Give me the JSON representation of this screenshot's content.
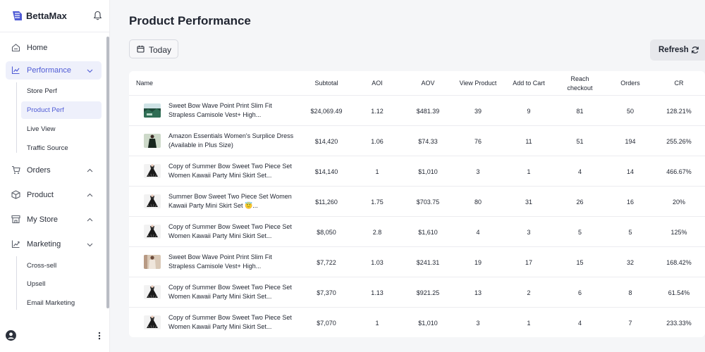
{
  "app": {
    "brand": "BettaMax"
  },
  "sidebar": {
    "items": [
      {
        "label": "Home",
        "icon": "home-icon"
      },
      {
        "label": "Performance",
        "icon": "chart-icon",
        "active": true,
        "expanded": true
      },
      {
        "label": "Orders",
        "icon": "cart-icon"
      },
      {
        "label": "Product",
        "icon": "box-icon"
      },
      {
        "label": "My Store",
        "icon": "store-icon"
      },
      {
        "label": "Marketing",
        "icon": "trend-icon",
        "expanded": true
      }
    ],
    "performance_sub": [
      {
        "label": "Store Perf"
      },
      {
        "label": "Product Perf",
        "active": true
      },
      {
        "label": "Live View"
      },
      {
        "label": "Traffic Source"
      }
    ],
    "marketing_sub": [
      {
        "label": "Cross-sell"
      },
      {
        "label": "Upsell"
      },
      {
        "label": "Email Marketing"
      }
    ]
  },
  "header": {
    "title": "Product Performance",
    "date_filter": "Today",
    "refresh_label": "Refresh"
  },
  "table": {
    "columns": [
      "Name",
      "Subtotal",
      "AOI",
      "AOV",
      "View Product",
      "Add to Cart",
      "Reach checkout",
      "Orders",
      "CR"
    ],
    "rows": [
      {
        "name": "Sweet Bow Wave Point Print Slim Fit Strapless Camisole Vest+ High...",
        "thumb": "landscape",
        "subtotal": "$24,069.49",
        "aoi": "1.12",
        "aov": "$481.39",
        "view": "39",
        "cart": "9",
        "checkout": "81",
        "orders": "50",
        "cr": "128.21%"
      },
      {
        "name": "Amazon Essentials Women's Surplice Dress (Available in Plus Size)",
        "thumb": "dress",
        "subtotal": "$14,420",
        "aoi": "1.06",
        "aov": "$74.33",
        "view": "76",
        "cart": "11",
        "checkout": "51",
        "orders": "194",
        "cr": "255.26%"
      },
      {
        "name": "Copy of Summer Bow Sweet Two Piece Set Women Kawaii Party Mini Skirt Set...",
        "thumb": "skirt",
        "subtotal": "$14,140",
        "aoi": "1",
        "aov": "$1,010",
        "view": "3",
        "cart": "1",
        "checkout": "4",
        "orders": "14",
        "cr": "466.67%"
      },
      {
        "name": "Summer Bow Sweet Two Piece Set Women Kawaii Party Mini Skirt Set 😇...",
        "thumb": "skirt",
        "subtotal": "$11,260",
        "aoi": "1.75",
        "aov": "$703.75",
        "view": "80",
        "cart": "31",
        "checkout": "26",
        "orders": "16",
        "cr": "20%"
      },
      {
        "name": "Copy of Summer Bow Sweet Two Piece Set Women Kawaii Party Mini Skirt Set...",
        "thumb": "skirt",
        "subtotal": "$8,050",
        "aoi": "2.8",
        "aov": "$1,610",
        "view": "4",
        "cart": "3",
        "checkout": "5",
        "orders": "5",
        "cr": "125%"
      },
      {
        "name": "Sweet Bow Wave Point Print Slim Fit Strapless Camisole Vest+ High...",
        "thumb": "beige",
        "subtotal": "$7,722",
        "aoi": "1.03",
        "aov": "$241.31",
        "view": "19",
        "cart": "17",
        "checkout": "15",
        "orders": "32",
        "cr": "168.42%"
      },
      {
        "name": "Copy of Summer Bow Sweet Two Piece Set Women Kawaii Party Mini Skirt Set...",
        "thumb": "skirt",
        "subtotal": "$7,370",
        "aoi": "1.13",
        "aov": "$921.25",
        "view": "13",
        "cart": "2",
        "checkout": "6",
        "orders": "8",
        "cr": "61.54%"
      },
      {
        "name": "Copy of Summer Bow Sweet Two Piece Set Women Kawaii Party Mini Skirt Set...",
        "thumb": "skirt",
        "subtotal": "$7,070",
        "aoi": "1",
        "aov": "$1,010",
        "view": "3",
        "cart": "1",
        "checkout": "4",
        "orders": "7",
        "cr": "233.33%"
      }
    ]
  },
  "colors": {
    "accent": "#4f5bd5",
    "active_bg": "#eef0fb"
  }
}
